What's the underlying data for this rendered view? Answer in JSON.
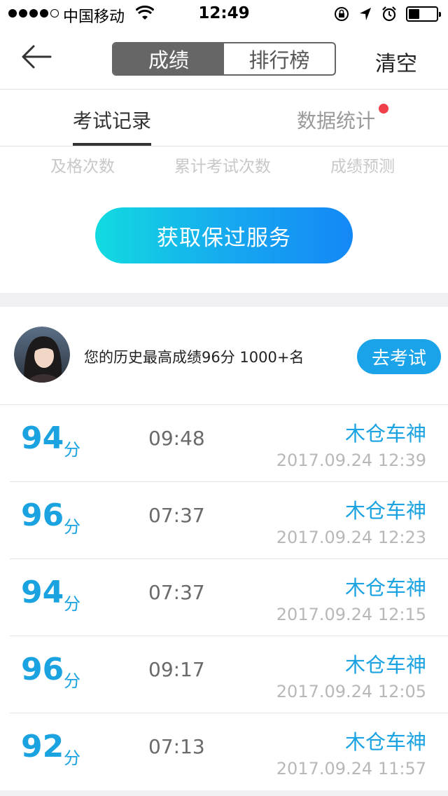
{
  "status_bar": {
    "carrier": "中国移动",
    "time": "12:49"
  },
  "nav": {
    "segments": [
      "成绩",
      "排行榜"
    ],
    "active_segment": 0,
    "clear_label": "清空"
  },
  "tabs": {
    "items": [
      "考试记录",
      "数据统计"
    ],
    "active": 0,
    "stats_badge": true
  },
  "stats_labels": [
    "及格次数",
    "累计考试次数",
    "成绩预测"
  ],
  "cta": {
    "label": "获取保过服务"
  },
  "profile": {
    "best_text": "您的历史最高成绩96分  1000+名",
    "go_exam_label": "去考试"
  },
  "records": [
    {
      "score": "94",
      "unit": "分",
      "duration": "09:48",
      "name": "木仓车神",
      "date": "2017.09.24 12:39"
    },
    {
      "score": "96",
      "unit": "分",
      "duration": "07:37",
      "name": "木仓车神",
      "date": "2017.09.24 12:23"
    },
    {
      "score": "94",
      "unit": "分",
      "duration": "07:37",
      "name": "木仓车神",
      "date": "2017.09.24 12:15"
    },
    {
      "score": "96",
      "unit": "分",
      "duration": "09:17",
      "name": "木仓车神",
      "date": "2017.09.24 12:05"
    },
    {
      "score": "92",
      "unit": "分",
      "duration": "07:13",
      "name": "木仓车神",
      "date": "2017.09.24 11:57"
    }
  ],
  "colors": {
    "accent": "#1aa3e0",
    "segment_active": "#666666",
    "badge": "#f0404a"
  }
}
